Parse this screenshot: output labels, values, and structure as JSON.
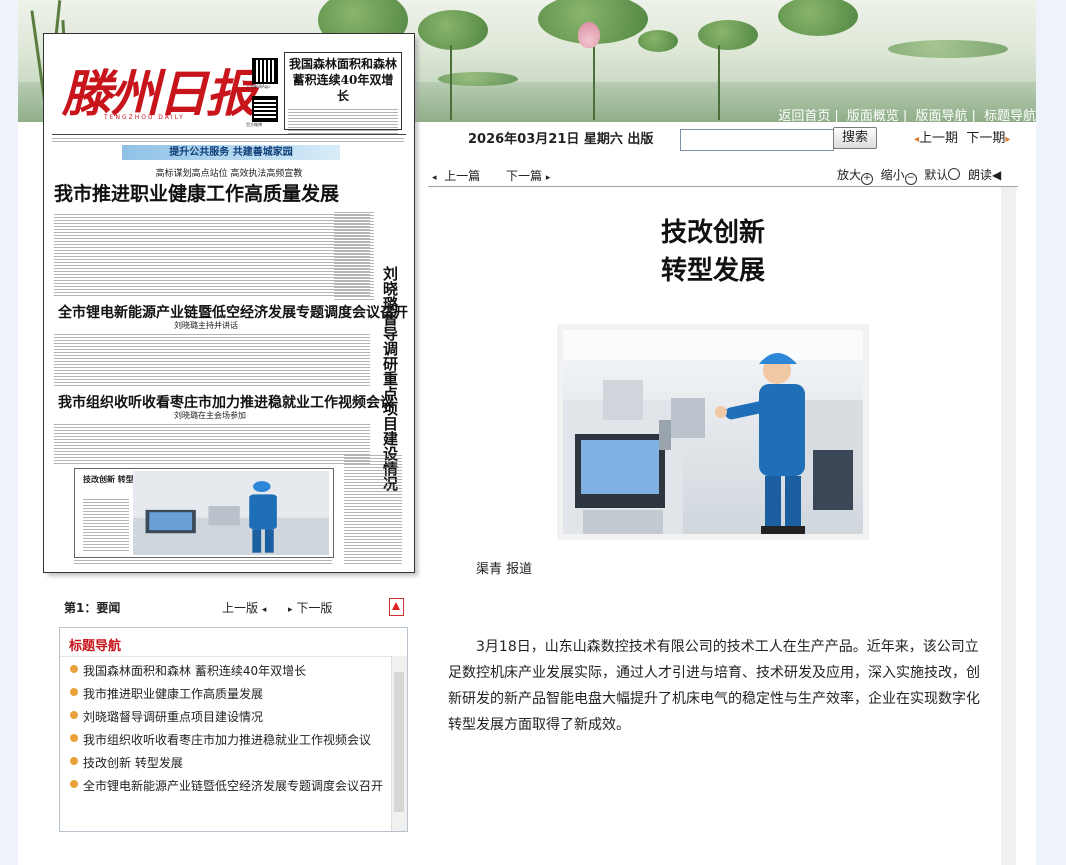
{
  "top_links": [
    "返回首页",
    "版面概览",
    "版面导航",
    "标题导航"
  ],
  "date_bar": "2026年03月21日 星期六 出版",
  "search": {
    "button": "搜索",
    "value": ""
  },
  "issue_nav": {
    "prev": "上一期",
    "next": "下一期"
  },
  "newspaper": {
    "masthead": "滕州日报",
    "masthead_pinyin": "TENGZHOU DAILY",
    "qr_label_1": "上游新闻App",
    "qr_label_2": "官方微博",
    "teaser": "我国森林面积和森林蓄积连续40年双增长",
    "tagline_band": "提升公共服务 共建善城家园",
    "pre_headline": "高标谋划高点站位 高效执法高频宣教",
    "headline_main": "我市推进职业健康工作高质量发展",
    "headline_2": "全市锂电新能源产业链暨低空经济发展专题调度会议召开",
    "sub_2": "刘晓璐主持并讲话",
    "headline_3": "我市组织收听收看枣庄市加力推进稳就业工作视频会议",
    "sub_3": "刘晓璐在主会场参加",
    "vertical_headline": "刘晓璐督导调研重点项目建设情况",
    "photo_caption": "技改创新 转型发展"
  },
  "page_nav": {
    "label": "第1：要闻",
    "prev": "上一版",
    "next": "下一版"
  },
  "title_nav": {
    "heading": "标题导航",
    "items": [
      "我国森林面积和森林 蓄积连续40年双增长",
      "我市推进职业健康工作高质量发展",
      "刘晓璐督导调研重点项目建设情况",
      "我市组织收听收看枣庄市加力推进稳就业工作视频会议",
      "技改创新 转型发展",
      "全市锂电新能源产业链暨低空经济发展专题调度会议召开"
    ]
  },
  "article": {
    "prev": "上一篇",
    "next": "下一篇",
    "tools": {
      "zoom_in": "放大",
      "zoom_out": "缩小",
      "default": "默认",
      "read": "朗读"
    },
    "title_line1": "技改创新",
    "title_line2": "转型发展",
    "byline": "渠青 报道",
    "body": "3月18日，山东山森数控技术有限公司的技术工人在生产产品。近年来，该公司立足数控机床产业发展实际，通过人才引进与培育、技术研发及应用，深入实施技改，创新研发的新产品智能电盘大幅提升了机床电气的稳定性与生产效率，企业在实现数字化转型发展方面取得了新成效。"
  },
  "colors": {
    "masthead_red": "#c8141b",
    "nav_dot": "#e8a23a",
    "workwear_blue": "#1f6fb8"
  }
}
